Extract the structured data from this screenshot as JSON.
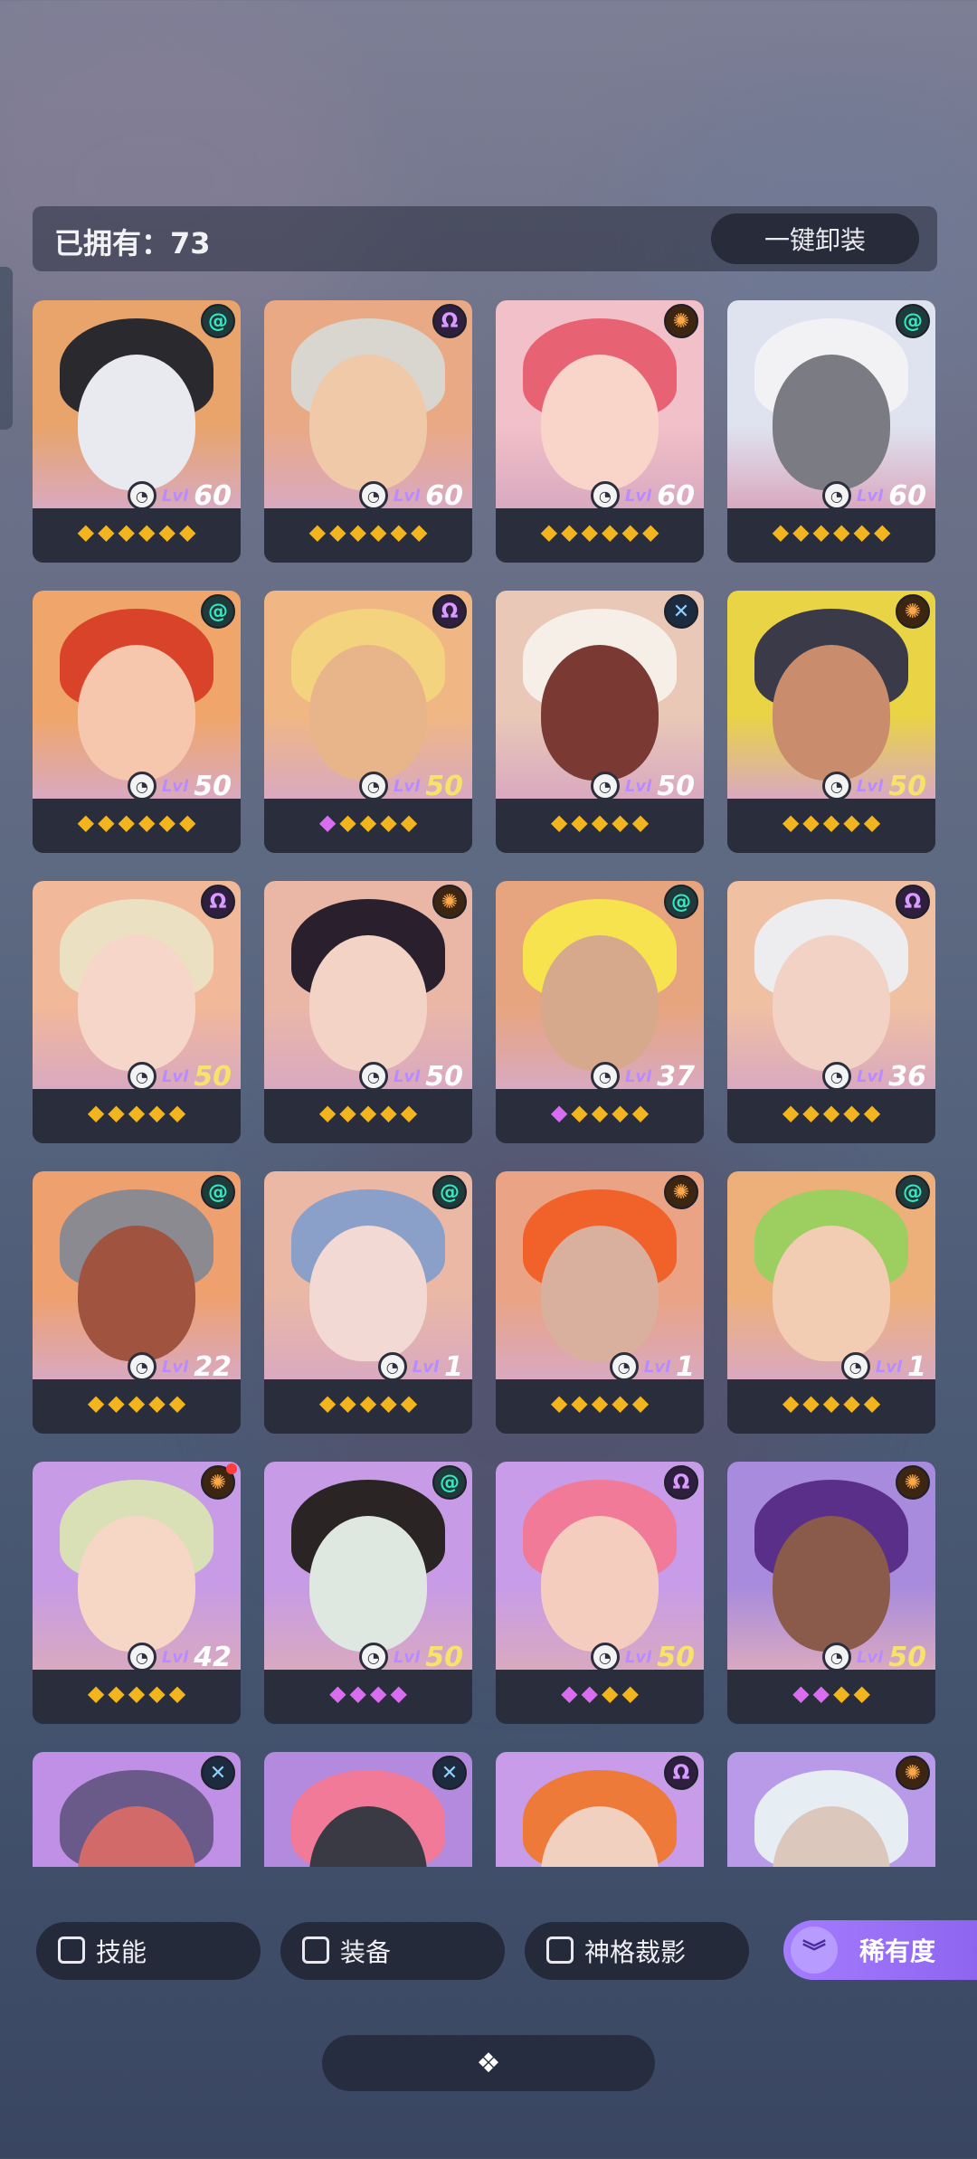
{
  "header": {
    "owned_label": "已拥有：73",
    "unequip_label": "一键卸装"
  },
  "lvl_word": "Lvl",
  "icons": {
    "green": "spiral-class-icon",
    "purple": "omega-class-icon",
    "orange": "sun-class-icon",
    "blue": "cross-class-icon",
    "level": "aperture-icon",
    "gem": "diamond-gem-icon"
  },
  "colors": {
    "gem_gold": "#f3b51e",
    "gem_purple": "#d86df0",
    "rarity_button": "#9b74f6"
  },
  "cards": [
    {
      "cls": "green",
      "level": "60",
      "gold": false,
      "gems": [
        "g",
        "g",
        "g",
        "g",
        "g",
        "g"
      ],
      "bg": "#e8a46a",
      "hair": "#2a2a2e",
      "face": "#e9e9f0"
    },
    {
      "cls": "purple",
      "level": "60",
      "gold": false,
      "gems": [
        "g",
        "g",
        "g",
        "g",
        "g",
        "g"
      ],
      "bg": "#eaa985",
      "hair": "#d8d6cf",
      "face": "#f0c9a8"
    },
    {
      "cls": "orange",
      "level": "60",
      "gold": false,
      "gems": [
        "g",
        "g",
        "g",
        "g",
        "g",
        "g"
      ],
      "bg": "#f2c0c8",
      "hair": "#e76373",
      "face": "#f8d4c9"
    },
    {
      "cls": "green",
      "level": "60",
      "gold": false,
      "gems": [
        "g",
        "g",
        "g",
        "g",
        "g",
        "g"
      ],
      "bg": "#dfe3f0",
      "hair": "#f2f2f5",
      "face": "#7b7b84"
    },
    {
      "cls": "green",
      "level": "50",
      "gold": false,
      "gems": [
        "g",
        "g",
        "g",
        "g",
        "g",
        "g"
      ],
      "bg": "#f0a66a",
      "hair": "#d9432a",
      "face": "#f6c7ad"
    },
    {
      "cls": "purple",
      "level": "50",
      "gold": true,
      "gems": [
        "p",
        "g",
        "g",
        "g",
        "g"
      ],
      "bg": "#f0b784",
      "hair": "#f3d37e",
      "face": "#e8b48a"
    },
    {
      "cls": "blue",
      "level": "50",
      "gold": false,
      "gems": [
        "g",
        "g",
        "g",
        "g",
        "g"
      ],
      "bg": "#e9c8b7",
      "hair": "#f5efe8",
      "face": "#7a3a33"
    },
    {
      "cls": "orange",
      "level": "50",
      "gold": true,
      "gems": [
        "g",
        "g",
        "g",
        "g",
        "g"
      ],
      "bg": "#e8d445",
      "hair": "#3a3a48",
      "face": "#c98d6e"
    },
    {
      "cls": "purple",
      "level": "50",
      "gold": true,
      "gems": [
        "g",
        "g",
        "g",
        "g",
        "g"
      ],
      "bg": "#f2b89a",
      "hair": "#ece0c2",
      "face": "#f5d6c8"
    },
    {
      "cls": "orange",
      "level": "50",
      "gold": false,
      "gems": [
        "g",
        "g",
        "g",
        "g",
        "g"
      ],
      "bg": "#eab7a7",
      "hair": "#2a1f2c",
      "face": "#f2d3c6"
    },
    {
      "cls": "green",
      "level": "37",
      "gold": false,
      "gems": [
        "p",
        "g",
        "g",
        "g",
        "g"
      ],
      "bg": "#e7a57f",
      "hair": "#f7e34e",
      "face": "#d7a98c"
    },
    {
      "cls": "purple",
      "level": "36",
      "gold": false,
      "gems": [
        "g",
        "g",
        "g",
        "g",
        "g"
      ],
      "bg": "#f0c0a3",
      "hair": "#ededf0",
      "face": "#f1d2c5"
    },
    {
      "cls": "green",
      "level": "22",
      "gold": false,
      "gems": [
        "g",
        "g",
        "g",
        "g",
        "g"
      ],
      "bg": "#eea06f",
      "hair": "#8a8a90",
      "face": "#a0543f"
    },
    {
      "cls": "green",
      "level": "1",
      "gold": false,
      "gems": [
        "g",
        "g",
        "g",
        "g",
        "g"
      ],
      "bg": "#eab8a5",
      "hair": "#8aa0c8",
      "face": "#f3d9d4"
    },
    {
      "cls": "orange",
      "level": "1",
      "gold": false,
      "gems": [
        "g",
        "g",
        "g",
        "g",
        "g"
      ],
      "bg": "#eaa384",
      "hair": "#f0622a",
      "face": "#d9b09e"
    },
    {
      "cls": "green",
      "level": "1",
      "gold": false,
      "gems": [
        "g",
        "g",
        "g",
        "g",
        "g"
      ],
      "bg": "#eeb07a",
      "hair": "#9ccf5f",
      "face": "#f3ccb4"
    },
    {
      "cls": "orange",
      "level": "42",
      "gold": false,
      "gems": [
        "g",
        "g",
        "g",
        "g",
        "g"
      ],
      "bg": "#c79be5",
      "hair": "#d9e0b5",
      "face": "#f6d6c4",
      "dot": true
    },
    {
      "cls": "green",
      "level": "50",
      "gold": true,
      "gems": [
        "p",
        "p",
        "p",
        "p"
      ],
      "bg": "#c79be5",
      "hair": "#2a2424",
      "face": "#dfe8e0"
    },
    {
      "cls": "purple",
      "level": "50",
      "gold": true,
      "gems": [
        "p",
        "p",
        "g",
        "g"
      ],
      "bg": "#c89ce8",
      "hair": "#f07a98",
      "face": "#f4cdbf"
    },
    {
      "cls": "orange",
      "level": "50",
      "gold": true,
      "gems": [
        "p",
        "p",
        "g",
        "g"
      ],
      "bg": "#a88bdc",
      "hair": "#5a2f8a",
      "face": "#8a5a4a"
    },
    {
      "cls": "blue",
      "level": "",
      "gold": false,
      "gems": [],
      "bg": "#c08fe6",
      "hair": "#6a5a8a",
      "face": "#d36a6a"
    },
    {
      "cls": "blue",
      "level": "",
      "gold": false,
      "gems": [],
      "bg": "#b48adf",
      "hair": "#f07a98",
      "face": "#3a3a44"
    },
    {
      "cls": "purple",
      "level": "",
      "gold": false,
      "gems": [],
      "bg": "#c89ce8",
      "hair": "#ee7a3a",
      "face": "#f2d0c0"
    },
    {
      "cls": "orange",
      "level": "",
      "gold": false,
      "gems": [],
      "bg": "#b89ae8",
      "hair": "#e6eef4",
      "face": "#dcc7bc"
    }
  ],
  "filters": {
    "skill": "技能",
    "equip": "装备",
    "divinity": "神格裁影",
    "rarity": "稀有度"
  },
  "bottom_bar_icon": "❖"
}
